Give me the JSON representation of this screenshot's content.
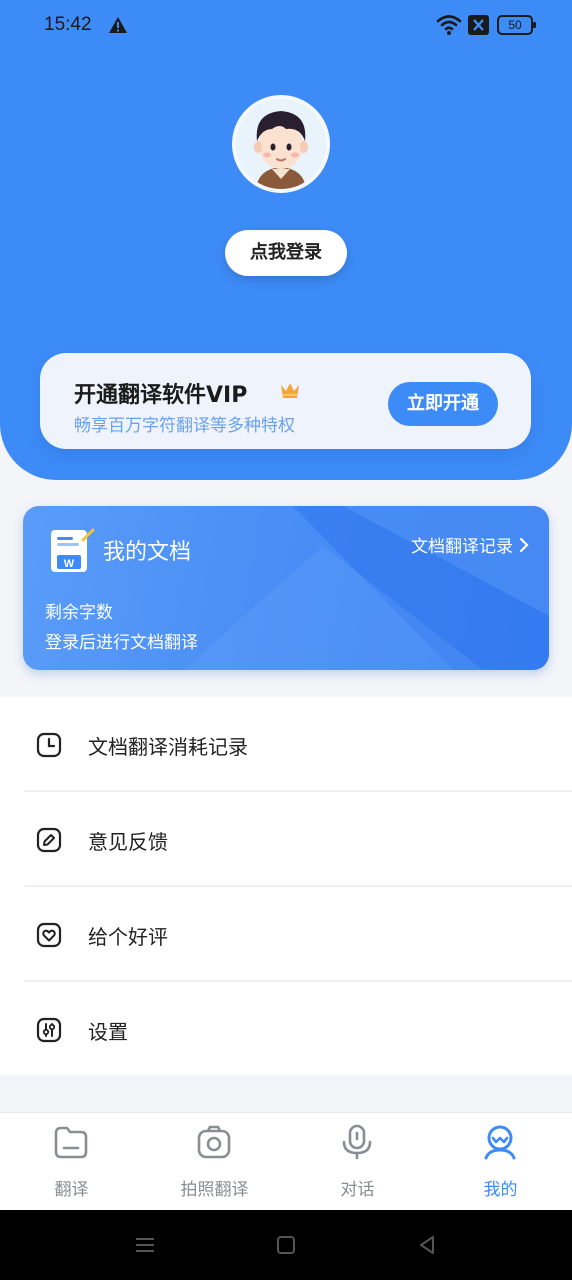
{
  "status_bar": {
    "time": "15:42",
    "battery": "50"
  },
  "profile": {
    "login_label": "点我登录"
  },
  "vip": {
    "title": "开通翻译软件VIP",
    "subtitle": "畅享百万字符翻译等多种特权",
    "button_label": "立即开通"
  },
  "documents": {
    "title": "我的文档",
    "history_label": "文档翻译记录",
    "remaining_label": "剩余字数",
    "hint": "登录后进行文档翻译"
  },
  "menu": {
    "items": [
      {
        "label": "文档翻译消耗记录",
        "icon": "clock-icon"
      },
      {
        "label": "意见反馈",
        "icon": "edit-icon"
      },
      {
        "label": "给个好评",
        "icon": "heart-icon"
      },
      {
        "label": "设置",
        "icon": "settings-icon"
      }
    ]
  },
  "tabs": [
    {
      "label": "翻译",
      "icon": "folder-icon",
      "active": false
    },
    {
      "label": "拍照翻译",
      "icon": "camera-icon",
      "active": false
    },
    {
      "label": "对话",
      "icon": "microphone-icon",
      "active": false
    },
    {
      "label": "我的",
      "icon": "profile-icon",
      "active": true
    }
  ],
  "colors": {
    "primary": "#3d8bf7",
    "vip_sub": "#6aa2ee",
    "tab_inactive": "#8a8d93"
  }
}
